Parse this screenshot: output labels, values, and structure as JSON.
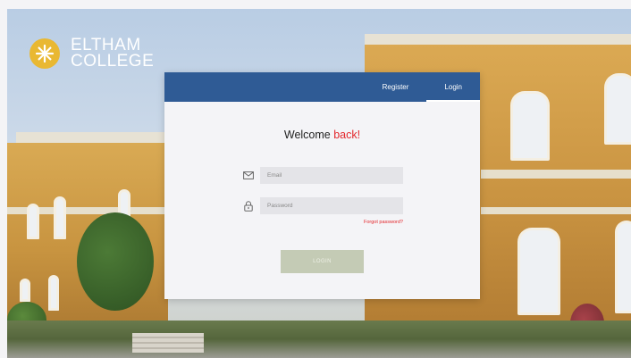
{
  "brand": {
    "line1": "ELTHAM",
    "line2": "COLLEGE",
    "mark_color": "#e9b832"
  },
  "header": {
    "color": "#2f5b95",
    "tabs": [
      {
        "label": "Register",
        "active": false
      },
      {
        "label": "Login",
        "active": true
      }
    ]
  },
  "welcome": {
    "prefix": "Welcome",
    "accent": "back!",
    "accent_color": "#e3262b"
  },
  "form": {
    "email": {
      "placeholder": "Email",
      "value": "",
      "icon": "envelope-icon"
    },
    "password": {
      "placeholder": "Password",
      "value": "",
      "icon": "lock-icon"
    },
    "forgot_label": "Forgot password?",
    "submit_label": "LOGIN"
  }
}
